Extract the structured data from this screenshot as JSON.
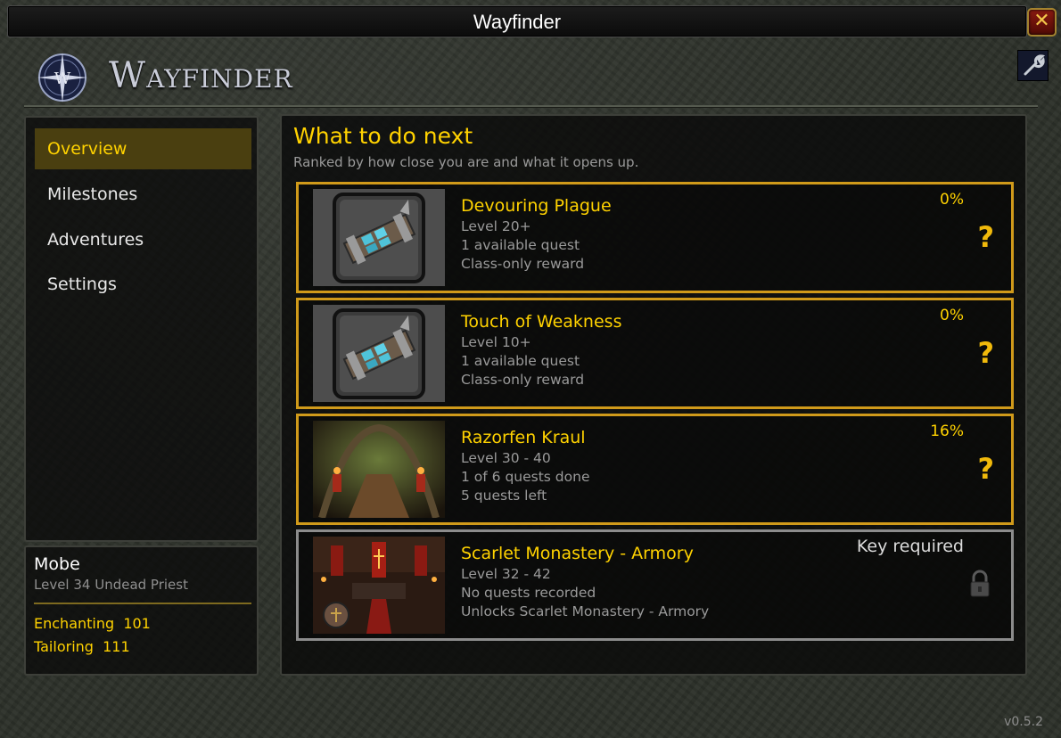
{
  "window": {
    "title": "Wayfinder",
    "close_icon": "close-icon",
    "close_glyph": "✕"
  },
  "header": {
    "logo_text": "Wayfinder",
    "logo_icon": "compass-rose-icon",
    "tool_icon": "wrench-icon"
  },
  "sidebar": {
    "items": [
      {
        "label": "Overview",
        "active": true
      },
      {
        "label": "Milestones",
        "active": false
      },
      {
        "label": "Adventures",
        "active": false
      },
      {
        "label": "Settings",
        "active": false
      }
    ]
  },
  "character": {
    "name": "Mobe",
    "subtitle": "Level 34 Undead Priest",
    "professions": [
      {
        "label": "Enchanting  101"
      },
      {
        "label": "Tailoring  111"
      }
    ]
  },
  "main": {
    "title": "What to do next",
    "subtitle": "Ranked by how close you are and what it opens up.",
    "cards": [
      {
        "name": "Devouring Plague",
        "lines": [
          "Level 20+",
          "1 available quest",
          "Class-only reward"
        ],
        "progress": "0%",
        "indicator": "?",
        "thumb": "bracer-icon",
        "locked": false
      },
      {
        "name": "Touch of Weakness",
        "lines": [
          "Level 10+",
          "1 available quest",
          "Class-only reward"
        ],
        "progress": "0%",
        "indicator": "?",
        "thumb": "bracer-icon",
        "locked": false
      },
      {
        "name": "Razorfen Kraul",
        "lines": [
          "Level 30 - 40",
          "1 of 6 quests done",
          "5 quests left"
        ],
        "progress": "16%",
        "indicator": "?",
        "thumb": "razorfen-kraul-image",
        "locked": false
      },
      {
        "name": "Scarlet Monastery - Armory",
        "lines": [
          "Level 32 - 42",
          "No quests recorded",
          "Unlocks Scarlet Monastery - Armory"
        ],
        "status": "Key required",
        "thumb": "scarlet-monastery-image",
        "locked": true,
        "lock_icon": "padlock-icon"
      }
    ]
  },
  "footer": {
    "version": "v0.5.2"
  },
  "colors": {
    "accent": "#ffd200",
    "card_border": "#d09a1a",
    "locked_border": "#8c8c8c",
    "active_nav_bg": "#4a3f10"
  }
}
